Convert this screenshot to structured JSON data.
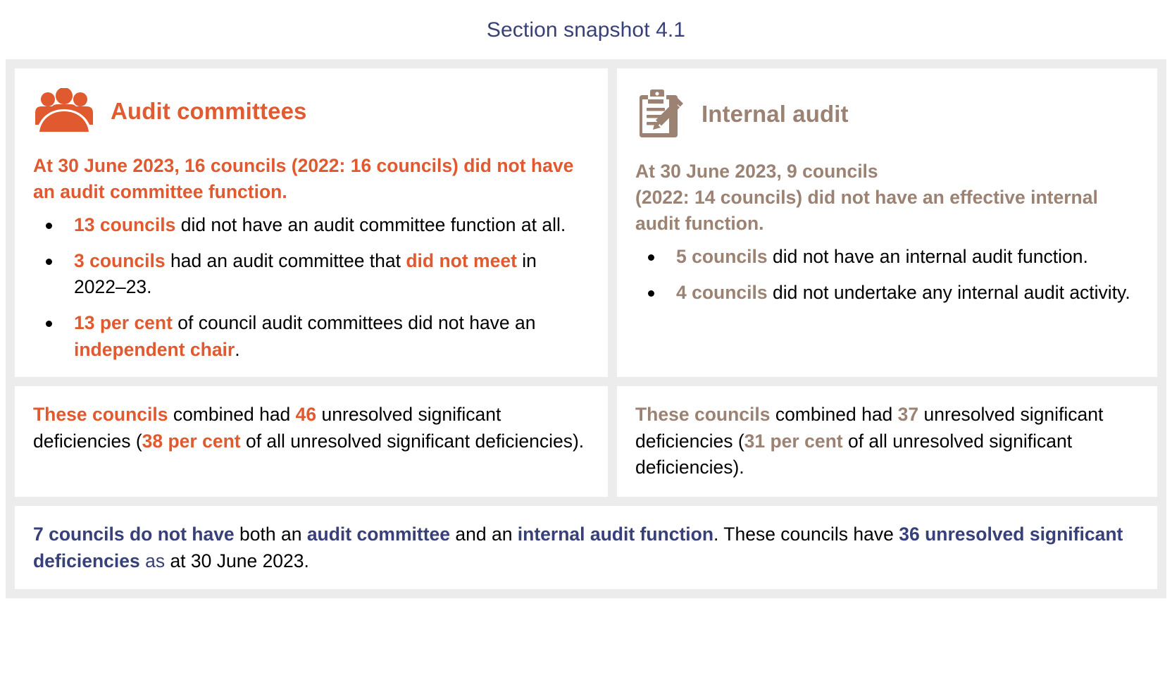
{
  "title": "Section snapshot 4.1",
  "colors": {
    "orange": "#e0592f",
    "brown": "#9b8273",
    "navy": "#38407a",
    "frame_grey": "#ececed",
    "card_white": "#ffffff",
    "body_black": "#000000"
  },
  "panels": {
    "audit_committees": {
      "icon": "people-group-icon",
      "heading": "Audit committees",
      "lead": "At 30 June 2023, 16 councils (2022: 16 councils) did not have an audit committee function.",
      "bullets": [
        {
          "highlight": "13 councils",
          "text": " did not have an audit committee function at all."
        },
        {
          "highlight": "3 councils",
          "text": " had an audit committee that ",
          "highlight2": "did not meet",
          "text2": " in 2022–23."
        },
        {
          "highlight": "13 per cent",
          "text": " of council audit committees did not have an ",
          "highlight2": "independent chair",
          "text2": "."
        }
      ],
      "summary": {
        "highlight": "These councils",
        "part1": " combined had ",
        "count": "46",
        "part2": " unresolved significant deficiencies (",
        "percent": "38 per cent",
        "part3": " of all unresolved significant deficiencies)."
      }
    },
    "internal_audit": {
      "icon": "clipboard-pencil-icon",
      "heading": "Internal audit",
      "lead": "At 30 June 2023, 9 councils (2022: 14 councils) did not have an effective internal audit function.",
      "lead_line1": "At 30 June 2023, 9 councils",
      "lead_line2": "(2022: 14 councils) did not have an effective internal audit function.",
      "bullets": [
        {
          "highlight": "5 councils",
          "text": " did not have an internal audit function."
        },
        {
          "highlight": "4 councils",
          "text": " did not undertake any internal audit activity."
        }
      ],
      "summary": {
        "highlight": "These councils",
        "part1": " combined had ",
        "count": "37",
        "part2": " unresolved significant deficiencies (",
        "percent": "31 per cent",
        "part3": " of all unresolved significant deficiencies)."
      }
    },
    "footer": {
      "highlight1": "7 councils do not have",
      "part1": " both an ",
      "highlight2": "audit committee",
      "part2": " and an ",
      "highlight3": "internal audit function",
      "part3": ". These councils have ",
      "highlight4": "36 unresolved significant deficiencies",
      "part4_navy": " as",
      "part5": " at 30 June 2023."
    }
  }
}
